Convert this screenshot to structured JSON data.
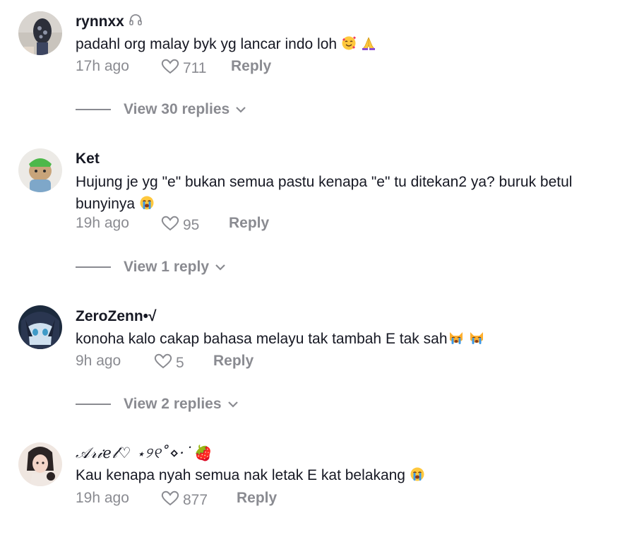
{
  "comments": [
    {
      "username": "rynnxx",
      "badge_icon": "headphones-icon",
      "text": "padahl org malay byk yg lancar indo loh",
      "emojis": [
        "smiling-face-hearts-emoji",
        "folded-hands-emoji"
      ],
      "time": "17h ago",
      "likes": "711",
      "reply_label": "Reply",
      "view_replies": "View 30 replies"
    },
    {
      "username": "Ket",
      "text": "Hujung je yg \"e\" bukan semua pastu kenapa \"e\" tu ditekan2 ya? buruk betul bunyinya",
      "emojis": [
        "loudly-crying-face-emoji"
      ],
      "time": "19h ago",
      "likes": "95",
      "reply_label": "Reply",
      "view_replies": "View 1 reply"
    },
    {
      "username": "ZeroZenn•√",
      "text": "konoha kalo cakap bahasa melayu tak tambah E tak sah",
      "emojis": [
        "crying-cat-emoji",
        "crying-cat-emoji"
      ],
      "time": "9h ago",
      "likes": "5",
      "reply_label": "Reply",
      "view_replies": "View 2 replies"
    },
    {
      "username": "𝒜𝓇𝒾𝑒𝓁♡ ⋆୨୧˚⋄·˙🍓",
      "text": "Kau kenapa nyah semua nak letak E kat belakang",
      "emojis": [
        "loudly-crying-face-emoji"
      ],
      "time": "19h ago",
      "likes": "877",
      "reply_label": "Reply"
    }
  ],
  "colors": {
    "text_primary": "#161823",
    "text_secondary": "#8a8b91"
  },
  "icons": {
    "like": "heart-outline-icon",
    "expand": "chevron-down-icon"
  }
}
